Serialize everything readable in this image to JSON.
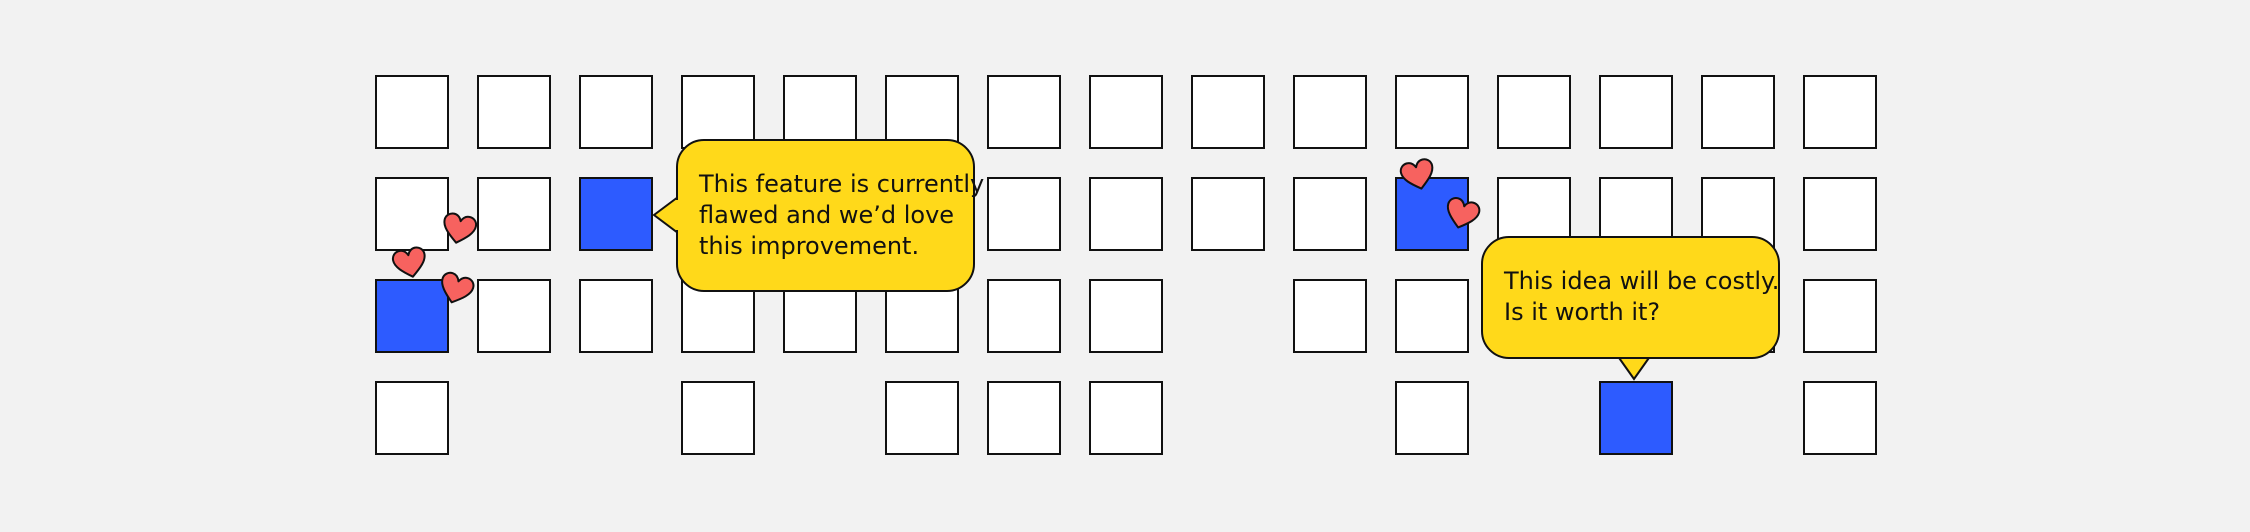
{
  "colors": {
    "background": "#f2f2f2",
    "tile_empty": "#ffffff",
    "tile_filled": "#2d5bff",
    "tile_border": "#111111",
    "bubble_fill": "#ffd91a",
    "heart_fill": "#f7625f",
    "text": "#111111"
  },
  "grid": {
    "rows": 4,
    "columns": 15,
    "cells": [
      [
        "empty",
        "empty",
        "empty",
        "empty",
        "empty",
        "empty",
        "empty",
        "empty",
        "empty",
        "empty",
        "empty",
        "empty",
        "empty",
        "empty",
        "empty"
      ],
      [
        "empty",
        "empty",
        "filled",
        "empty",
        "empty",
        "empty",
        "empty",
        "empty",
        "empty",
        "empty",
        "filled",
        "empty",
        "empty",
        "empty",
        "empty"
      ],
      [
        "filled",
        "empty",
        "empty",
        "empty",
        "empty",
        "empty",
        "empty",
        "empty",
        "none",
        "empty",
        "empty",
        "empty",
        "empty",
        "empty",
        "empty"
      ],
      [
        "empty",
        "none",
        "none",
        "empty",
        "none",
        "empty",
        "empty",
        "empty",
        "none",
        "none",
        "empty",
        "none",
        "filled",
        "none",
        "empty"
      ]
    ]
  },
  "comments": [
    {
      "lines": [
        "This feature is currently",
        "flawed and we’d love",
        "this improvement."
      ],
      "tail": "left"
    },
    {
      "lines": [
        "This idea will be costly.",
        "Is it worth it?"
      ],
      "tail": "bottom"
    }
  ],
  "reactions": [
    {
      "icon": "heart-icon"
    },
    {
      "icon": "heart-icon"
    },
    {
      "icon": "heart-icon"
    },
    {
      "icon": "heart-icon"
    },
    {
      "icon": "heart-icon"
    }
  ]
}
